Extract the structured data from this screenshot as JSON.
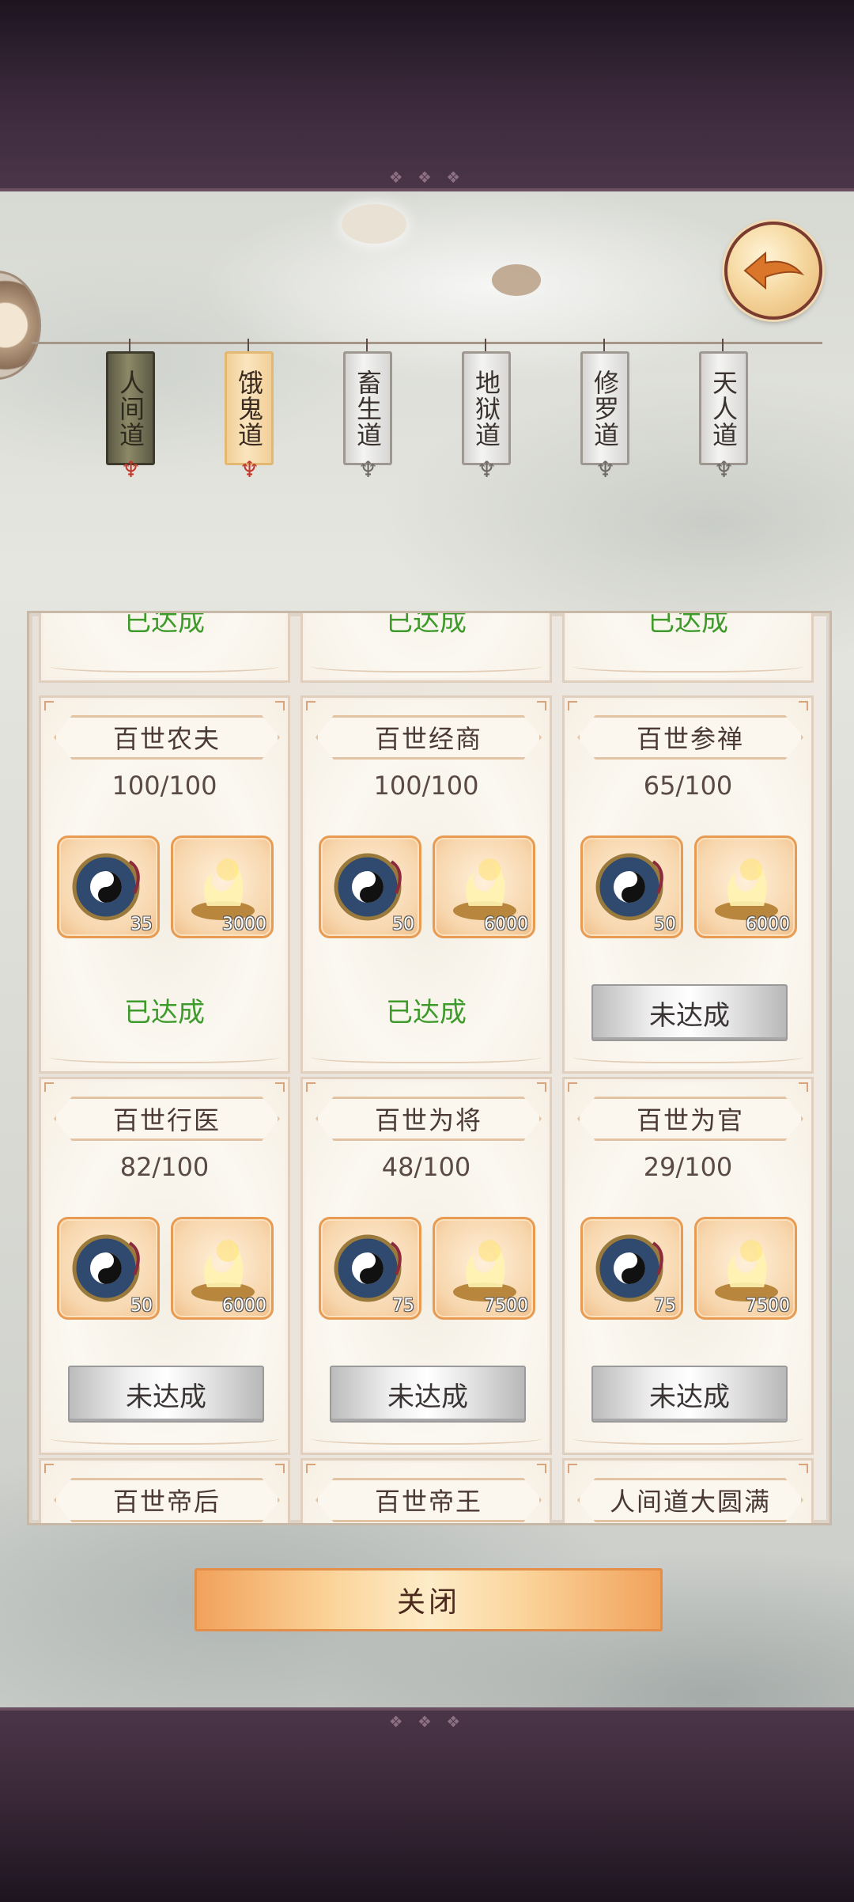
{
  "realm_tabs": [
    {
      "label": "人间道",
      "state": "active"
    },
    {
      "label": "饿鬼道",
      "state": "highlighted"
    },
    {
      "label": "畜生道",
      "state": "normal"
    },
    {
      "label": "地狱道",
      "state": "normal"
    },
    {
      "label": "修罗道",
      "state": "normal"
    },
    {
      "label": "天人道",
      "state": "normal"
    }
  ],
  "top_row_status": [
    "已达成",
    "已达成",
    "已达成"
  ],
  "achievements": [
    {
      "title": "百世农夫",
      "progress": "100/100",
      "reward1": "35",
      "reward2": "3000",
      "status": "已达成",
      "done": true
    },
    {
      "title": "百世经商",
      "progress": "100/100",
      "reward1": "50",
      "reward2": "6000",
      "status": "已达成",
      "done": true
    },
    {
      "title": "百世参禅",
      "progress": "65/100",
      "reward1": "50",
      "reward2": "6000",
      "status": "未达成",
      "done": false
    },
    {
      "title": "百世行医",
      "progress": "82/100",
      "reward1": "50",
      "reward2": "6000",
      "status": "未达成",
      "done": false
    },
    {
      "title": "百世为将",
      "progress": "48/100",
      "reward1": "75",
      "reward2": "7500",
      "status": "未达成",
      "done": false
    },
    {
      "title": "百世为官",
      "progress": "29/100",
      "reward1": "75",
      "reward2": "7500",
      "status": "未达成",
      "done": false
    }
  ],
  "bottom_row_titles": [
    "百世帝后",
    "百世帝王",
    "人间道大圆满"
  ],
  "icons": {
    "back": "back-arrow-icon",
    "reward1": "taiji-compass-icon",
    "reward2": "incense-burner-icon"
  },
  "colors": {
    "done_text": "#3d9a2b",
    "accent": "#f1a25b"
  },
  "close_label": "关闭"
}
